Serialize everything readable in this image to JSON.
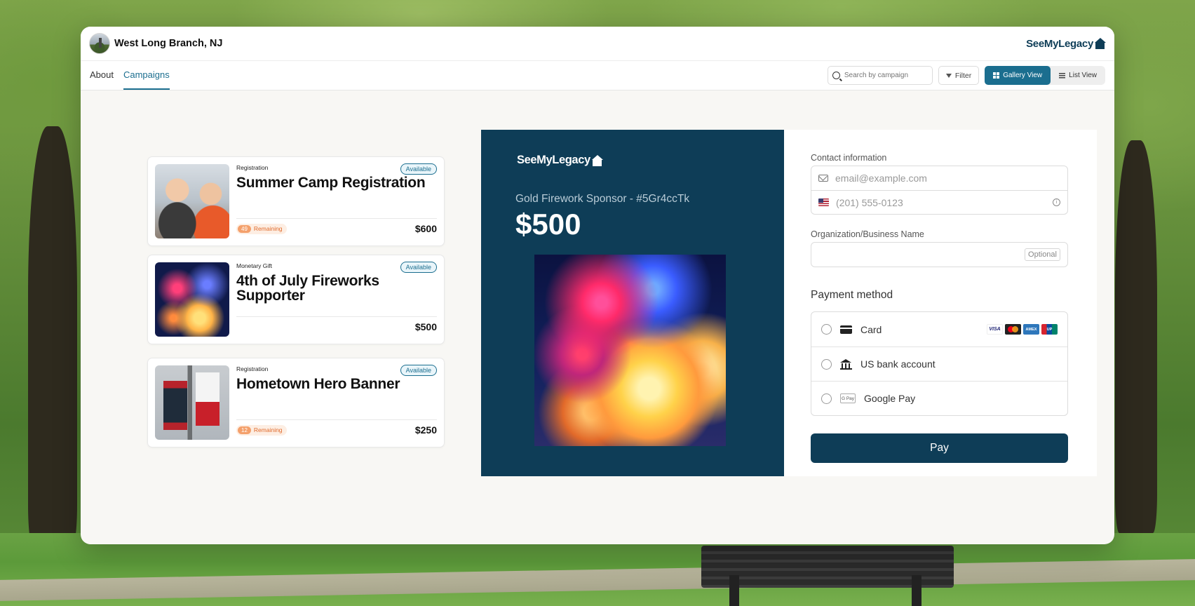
{
  "header": {
    "town": "West Long Branch, NJ",
    "brand": "SeeMyLegacy"
  },
  "nav": {
    "tabs": [
      {
        "label": "About",
        "active": false
      },
      {
        "label": "Campaigns",
        "active": true
      }
    ],
    "search_placeholder": "Search by campaign",
    "filter_label": "Filter",
    "gallery_view_label": "Gallery View",
    "list_view_label": "List View"
  },
  "campaigns": [
    {
      "tag": "Registration",
      "badge": "Available",
      "title": "Summer Camp Registration",
      "remaining_count": "49",
      "remaining_label": "Remaining",
      "price": "$600",
      "image": "kids-photo"
    },
    {
      "tag": "Monetary Gift",
      "badge": "Available",
      "title": "4th of July Fireworks Supporter",
      "price": "$500",
      "image": "fireworks-photo"
    },
    {
      "tag": "Registration",
      "badge": "Available",
      "title": "Hometown Hero Banner",
      "remaining_count": "12",
      "remaining_label": "Remaining",
      "price": "$250",
      "image": "banner-photo"
    }
  ],
  "checkout": {
    "brand": "SeeMyLegacy",
    "product": "Gold Firework Sponsor - #5Gr4ccTk",
    "amount": "$500",
    "contact_label": "Contact information",
    "email_placeholder": "email@example.com",
    "phone_placeholder": "(201) 555-0123",
    "org_label": "Organization/Business Name",
    "org_optional": "Optional",
    "payment_title": "Payment method",
    "payment_methods": [
      {
        "label": "Card",
        "icon": "card-icon"
      },
      {
        "label": "US bank account",
        "icon": "bank-icon"
      },
      {
        "label": "Google Pay",
        "icon": "gpay-icon"
      }
    ],
    "card_brands": [
      "VISA",
      "MC",
      "AMEX",
      "UP"
    ],
    "pay_label": "Pay"
  },
  "colors": {
    "primary": "#0e3d57",
    "accent": "#1b6e8f",
    "remaining": "#e06a2b"
  }
}
